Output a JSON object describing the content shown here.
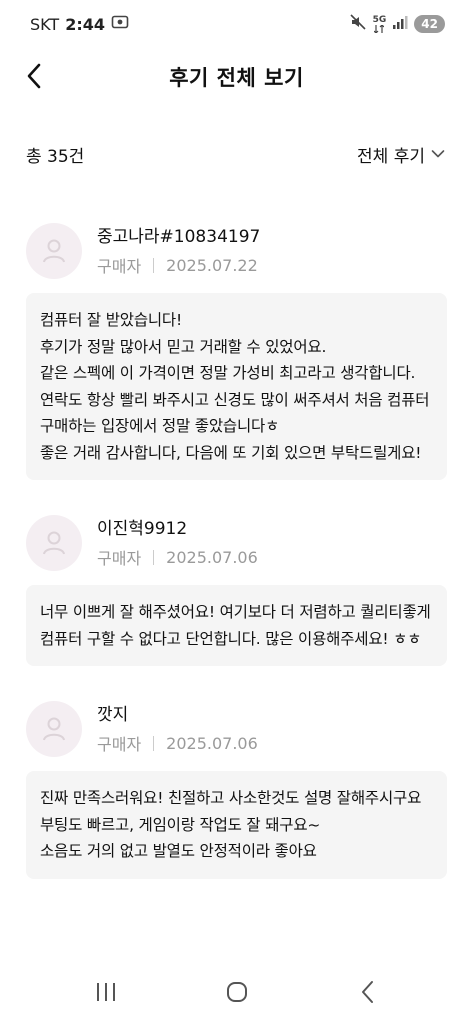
{
  "status": {
    "carrier": "SKT",
    "time": "2:44",
    "network": "5G",
    "battery": "42"
  },
  "header": {
    "title": "후기 전체 보기"
  },
  "summary": {
    "total": "총 35건",
    "filter_label": "전체 후기"
  },
  "reviews": [
    {
      "nickname": "중고나라#10834197",
      "role": "구매자",
      "date": "2025.07.22",
      "text": "컴퓨터 잘 받았습니다!\n후기가 정말 많아서 믿고 거래할 수 있었어요.\n같은 스펙에 이 가격이면 정말 가성비 최고라고 생각합니다.\n연락도 항상 빨리 봐주시고 신경도 많이 써주셔서 처음 컴퓨터 구매하는 입장에서 정말 좋았습니다ㅎ\n좋은 거래 감사합니다, 다음에 또 기회 있으면 부탁드릴게요!"
    },
    {
      "nickname": "이진혁9912",
      "role": "구매자",
      "date": "2025.07.06",
      "text": "너무 이쁘게 잘 해주셨어요! 여기보다 더 저렴하고 퀄리티좋게 컴퓨터 구할 수 없다고 단언합니다. 많은 이용해주세요! ㅎㅎ"
    },
    {
      "nickname": "깟지",
      "role": "구매자",
      "date": "2025.07.06",
      "text": "진짜 만족스러워요! 친절하고 사소한것도 설명 잘해주시구요\n부팅도 빠르고, 게임이랑 작업도 잘 돼구요~\n소음도 거의 없고 발열도 안정적이라 좋아요"
    }
  ]
}
